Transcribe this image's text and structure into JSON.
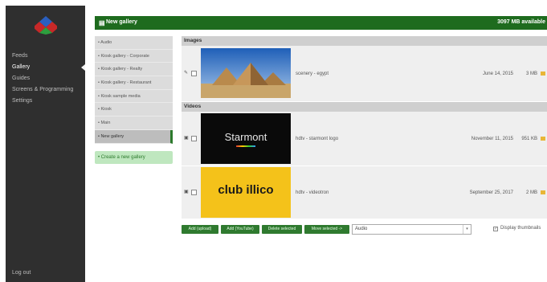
{
  "sidebar": {
    "items": [
      {
        "label": "Feeds"
      },
      {
        "label": "Gallery"
      },
      {
        "label": "Guides"
      },
      {
        "label": "Screens & Programming"
      },
      {
        "label": "Settings"
      }
    ],
    "logout_label": "Log out"
  },
  "header": {
    "title": "New gallery",
    "available": "3097 MB available"
  },
  "galleries": {
    "items": [
      {
        "label": "• Audio"
      },
      {
        "label": "• Kiosk gallery - Corporate"
      },
      {
        "label": "• Kiosk gallery - Realty"
      },
      {
        "label": "• Kiosk gallery - Restaurant"
      },
      {
        "label": "• Kiosk sample media"
      },
      {
        "label": "• Kiosk"
      },
      {
        "label": "• Main"
      },
      {
        "label": "• New gallery"
      }
    ],
    "create_label": "• Create a new gallery"
  },
  "main": {
    "images_heading": "Images",
    "videos_heading": "Videos",
    "images": [
      {
        "name": "scenery - egypt",
        "date": "June 14, 2015",
        "size": "3 MB"
      }
    ],
    "videos": [
      {
        "name": "hdtv - starmont logo",
        "date": "November 11, 2015",
        "size": "951 KB",
        "thumb_text": "Starmont"
      },
      {
        "name": "hdtv - videotron",
        "date": "September 25, 2017",
        "size": "2 MB",
        "thumb_text": "club illico"
      }
    ]
  },
  "toolbar": {
    "add_upload": "Add (upload)",
    "add_youtube": "Add (YouTube)",
    "delete_selected": "Delete selected",
    "move_selected": "Move selected ->",
    "move_target": "Audio",
    "display_thumbnails": "Display thumbnails"
  },
  "colors": {
    "header_green": "#1e6b1e",
    "button_green": "#2f7a2f",
    "sidebar_dark": "#2f2f2f"
  }
}
